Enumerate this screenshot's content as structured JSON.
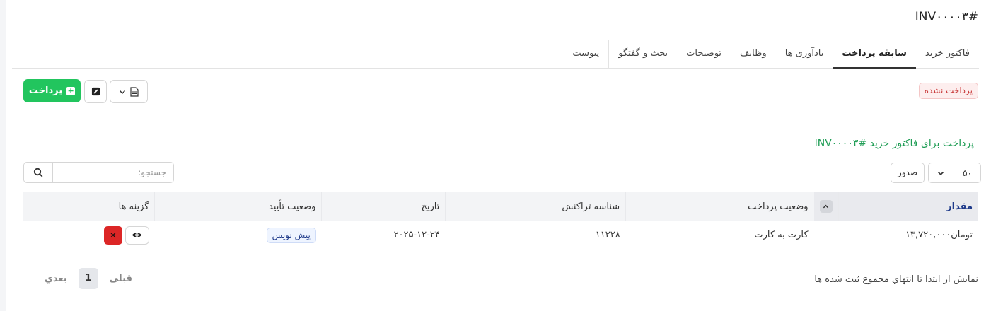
{
  "invoice": {
    "title": "INV۰۰۰۰۳#",
    "status": "پرداخت نشده"
  },
  "tabs": [
    {
      "label": "فاکتور خرید"
    },
    {
      "label": "سابقه پرداخت"
    },
    {
      "label": "یادآوری ها"
    },
    {
      "label": "وظایف"
    },
    {
      "label": "توضیحات"
    },
    {
      "label": "بحث و گفتگو"
    },
    {
      "label": "پیوست"
    }
  ],
  "actions": {
    "pay_label": "پرداخت"
  },
  "section": {
    "title": "پرداخت برای فاکتور خرید #INV۰۰۰۰۳"
  },
  "controls": {
    "per_page": "۵۰",
    "export_label": "صدور",
    "search_placeholder": "جستجو:"
  },
  "table": {
    "headers": {
      "amount": "مقدار",
      "payment_status": "وضعیت پرداخت",
      "transaction_id": "شناسه تراکنش",
      "date": "تاریخ",
      "approval_status": "وضعیت تأیید",
      "options": "گزینه ها"
    },
    "rows": [
      {
        "amount": "تومان۱۳,۷۲۰,۰۰۰",
        "payment_status": "کارت به کارت",
        "transaction_id": "۱۱۲۲۸",
        "date": "۲۰۲۵-۱۲-۲۴",
        "approval_status": "پیش نویس"
      }
    ]
  },
  "footer": {
    "info": "نمایش از ابتدا تا انتهاي مجموع ثبت شده ها",
    "prev": "قبلي",
    "current_page": "1",
    "next": "بعدي"
  },
  "colors": {
    "accent_green": "#22c55e",
    "danger_red": "#dc2626",
    "header_blue": "#1e3a8a"
  }
}
